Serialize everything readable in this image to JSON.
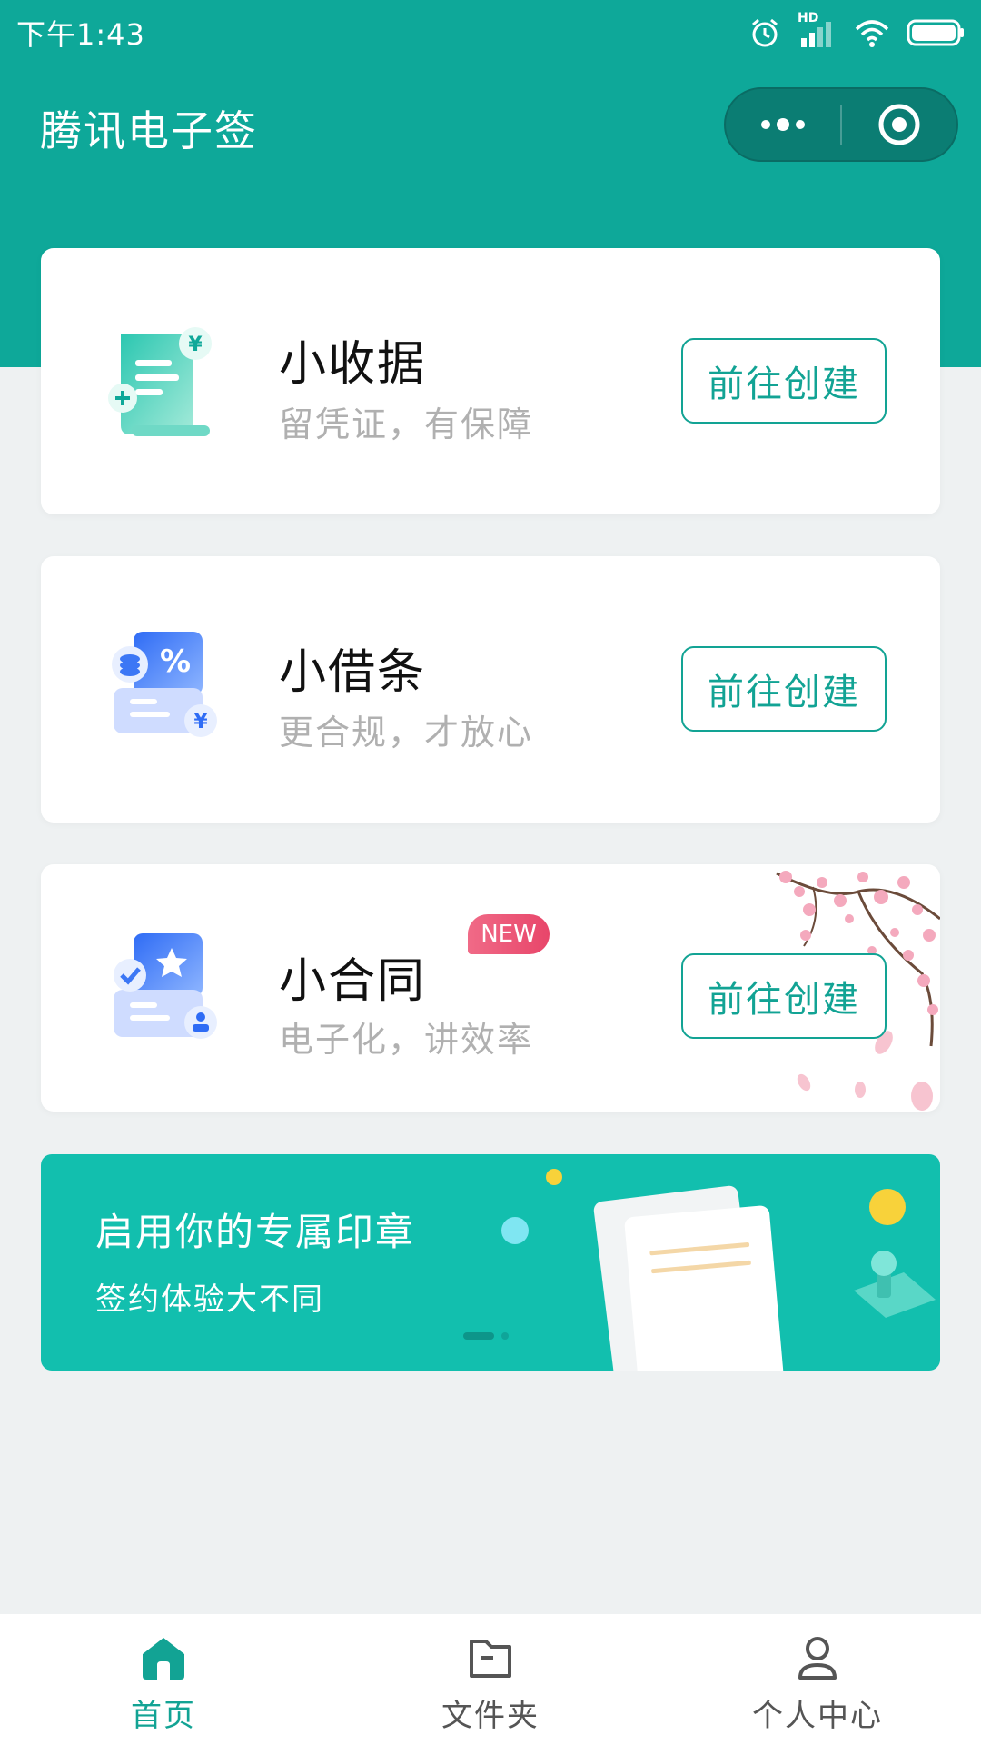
{
  "status_bar": {
    "time": "下午1:43",
    "network_label": "HD"
  },
  "header": {
    "title": "腾讯电子签"
  },
  "cards": [
    {
      "title": "小收据",
      "subtitle": "留凭证，有保障",
      "button": "前往创建"
    },
    {
      "title": "小借条",
      "subtitle": "更合规，才放心",
      "button": "前往创建"
    },
    {
      "title": "小合同",
      "subtitle": "电子化，讲效率",
      "button": "前往创建",
      "badge": "NEW"
    }
  ],
  "banner": {
    "title": "启用你的专属印章",
    "subtitle": "签约体验大不同"
  },
  "tabbar": [
    {
      "label": "首页",
      "active": true
    },
    {
      "label": "文件夹",
      "active": false
    },
    {
      "label": "个人中心",
      "active": false
    }
  ],
  "colors": {
    "brand": "#0ea899",
    "accent": "#12a394",
    "banner": "#12bfae",
    "badge": "#e8466a"
  }
}
